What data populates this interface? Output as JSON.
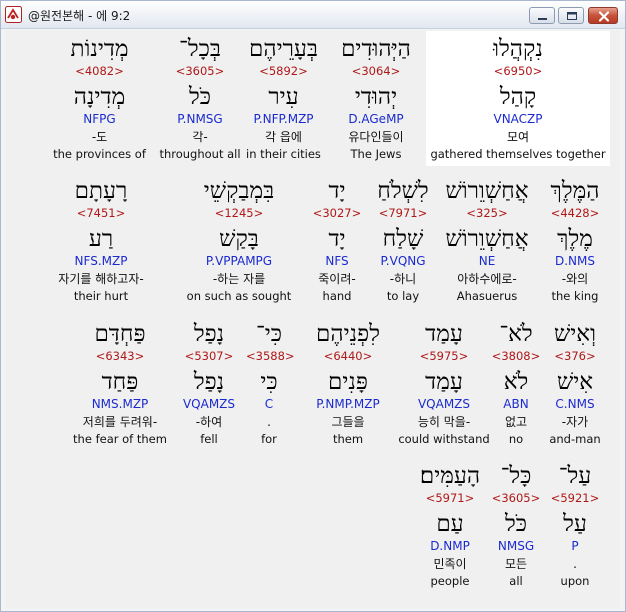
{
  "window": {
    "title": "@원전본해 - 에 9:2",
    "controls": {
      "minimize": "minimize",
      "maximize": "maximize",
      "close": "close"
    }
  },
  "rows": [
    [
      {
        "word": "נִקְהֲלוּ",
        "strong": "<6950>",
        "lemma": "קָהַל",
        "morph": "VNACZP",
        "korean": "모여",
        "english": "gathered themselves together",
        "highlight": true
      },
      {
        "word": "הַיְּהוּדִים",
        "strong": "<3064>",
        "lemma": "יְהוּדִי",
        "morph": "D.AGeMP",
        "korean": "유다인들이",
        "english": "The Jews"
      },
      {
        "word": "בְּעָרֵיהֶם",
        "strong": "<5892>",
        "lemma": "עִיר",
        "morph": "P.NFP.MZP",
        "korean": "각 읍에",
        "english": "in their cities"
      },
      {
        "word": "בְּכָל־",
        "strong": "<3605>",
        "lemma": "כֹּל",
        "morph": "P.NMSG",
        "korean": "각-",
        "english": "throughout all"
      },
      {
        "word": "מְדִינוֹת",
        "strong": "<4082>",
        "lemma": "מְדִינָה",
        "morph": "NFPG",
        "korean": "-도",
        "english": "the provinces of"
      }
    ],
    [
      {
        "word": "הַמֶּלֶךְ",
        "strong": "<4428>",
        "lemma": "מֶלֶךְ",
        "morph": "D.NMS",
        "korean": "-와의",
        "english": "the king"
      },
      {
        "word": "אֲחַשְׁוֵרוֹשׁ",
        "strong": "<325>",
        "lemma": "אֲחַשְׁוֵרוֹשׁ",
        "morph": "NE",
        "korean": "아하수에로-",
        "english": "Ahasuerus"
      },
      {
        "word": "לִשְׁלֹחַ",
        "strong": "<7971>",
        "lemma": "שָׁלַח",
        "morph": "P.VQNG",
        "korean": "-하니",
        "english": "to lay"
      },
      {
        "word": "יָד",
        "strong": "<3027>",
        "lemma": "יָד",
        "morph": "NFS",
        "korean": "죽이려-",
        "english": "hand"
      },
      {
        "word": "בִּמְבַקְשֵׁי",
        "strong": "<1245>",
        "lemma": "בָּקַשׁ",
        "morph": "P.VPPAMPG",
        "korean": "-하는 자를",
        "english": "on such as sought"
      },
      {
        "word": "רָעָתָם",
        "strong": "<7451>",
        "lemma": "רַע",
        "morph": "NFS.MZP",
        "korean": "자기를 해하고자-",
        "english": "their hurt"
      }
    ],
    [
      {
        "word": "וְאִישׁ",
        "strong": "<376>",
        "lemma": "אִישׁ",
        "morph": "C.NMS",
        "korean": "-자가",
        "english": "and-man"
      },
      {
        "word": "לֹא־",
        "strong": "<3808>",
        "lemma": "לֹא",
        "morph": "ABN",
        "korean": "없고",
        "english": "no"
      },
      {
        "word": "עָמַד",
        "strong": "<5975>",
        "lemma": "עָמַד",
        "morph": "VQAMZS",
        "korean": "능히 막을-",
        "english": "could withstand"
      },
      {
        "word": "לִפְנֵיהֶם",
        "strong": "<6440>",
        "lemma": "פָּנִים",
        "morph": "P.NMP.MZP",
        "korean": "그들을",
        "english": "them"
      },
      {
        "word": "כִּי־",
        "strong": "<3588>",
        "lemma": "כִּי",
        "morph": "C",
        "korean": ".",
        "english": "for"
      },
      {
        "word": "נָפַל",
        "strong": "<5307>",
        "lemma": "נָפַל",
        "morph": "VQAMZS",
        "korean": "-하여",
        "english": "fell"
      },
      {
        "word": "פַּחְדָּם",
        "strong": "<6343>",
        "lemma": "פַּחַד",
        "morph": "NMS.MZP",
        "korean": "저희를 두려워-",
        "english": "the fear of them"
      }
    ],
    [
      {
        "word": "עַל־",
        "strong": "<5921>",
        "lemma": "עַל",
        "morph": "P",
        "korean": ".",
        "english": "upon"
      },
      {
        "word": "כָּל־",
        "strong": "<3605>",
        "lemma": "כֹּל",
        "morph": "NMSG",
        "korean": "모든",
        "english": "all"
      },
      {
        "word": "הָעַמִּים׃",
        "strong": "<5971>",
        "lemma": "עַם",
        "morph": "D.NMP",
        "korean": "민족이",
        "english": "people"
      }
    ]
  ]
}
